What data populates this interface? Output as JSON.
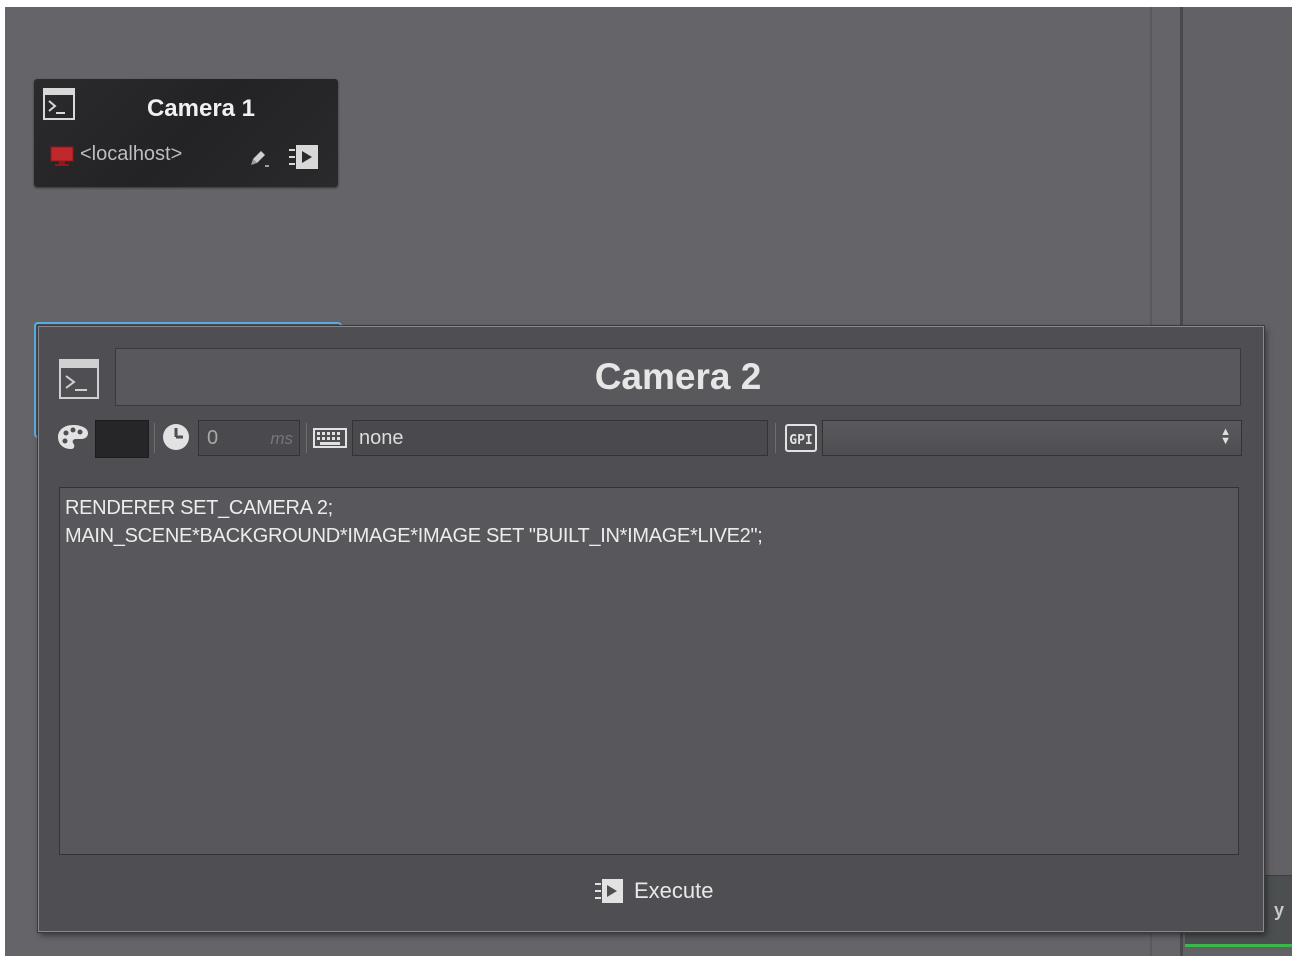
{
  "tile1": {
    "title": "Camera 1",
    "host": "<localhost>"
  },
  "dialog": {
    "title": "Camera 2",
    "delay": {
      "value": "0",
      "unit": "ms"
    },
    "hotkey": {
      "value": "none"
    },
    "gpi": {
      "selected": ""
    },
    "code_lines": [
      "RENDERER SET_CAMERA 2;",
      "MAIN_SCENE*BACKGROUND*IMAGE*IMAGE SET \"BUILT_IN*IMAGE*LIVE2\";"
    ],
    "execute_label": "Execute"
  },
  "right_panel": {
    "stub_label": "y"
  },
  "colors": {
    "canvas": "#656569",
    "selection_outline": "#5aaee0",
    "monitor_red": "#c0282c",
    "status_green": "#3ab84a"
  },
  "icons": [
    "terminal-icon",
    "monitor-icon",
    "pencil-icon",
    "execute-icon",
    "palette-icon",
    "clock-icon",
    "keyboard-icon",
    "gpi-icon",
    "select-arrows-icon"
  ]
}
